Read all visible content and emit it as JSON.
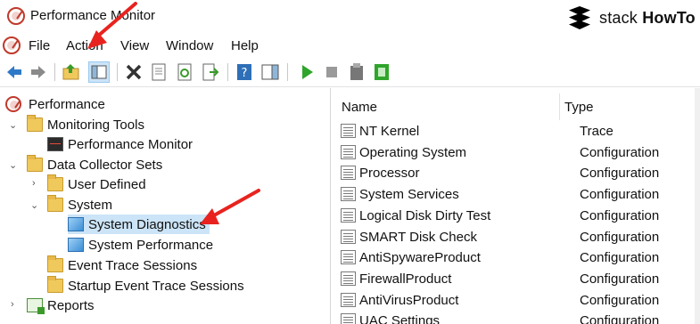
{
  "window": {
    "title": "Performance Monitor"
  },
  "brand": {
    "prefix": "stack",
    "suffix": "HowTo"
  },
  "menu": [
    "File",
    "Action",
    "View",
    "Window",
    "Help"
  ],
  "toolbar": {
    "buttons": [
      "back-icon",
      "forward-icon",
      "folder-up-icon",
      "show-hide-tree-icon",
      "delete-icon",
      "properties-icon",
      "refresh-icon",
      "export-icon",
      "help-icon",
      "show-hide-action-pane-icon",
      "start-icon",
      "stop-icon",
      "latest-report-icon",
      "new-data-collector-icon"
    ]
  },
  "tree": {
    "root": "Performance",
    "items": [
      {
        "label": "Monitoring Tools",
        "icon": "folder-icon",
        "expanded": true
      },
      {
        "label": "Performance Monitor",
        "icon": "monitor-icon"
      },
      {
        "label": "Data Collector Sets",
        "icon": "folder-icon",
        "expanded": true
      },
      {
        "label": "User Defined",
        "icon": "user-folder-icon",
        "expanded": false
      },
      {
        "label": "System",
        "icon": "system-folder-icon",
        "expanded": true
      },
      {
        "label": "System Diagnostics",
        "icon": "data-collector-icon",
        "selected": true
      },
      {
        "label": "System Performance",
        "icon": "data-collector-icon"
      },
      {
        "label": "Event Trace Sessions",
        "icon": "trace-folder-icon"
      },
      {
        "label": "Startup Event Trace Sessions",
        "icon": "trace-folder-icon"
      },
      {
        "label": "Reports",
        "icon": "reports-icon",
        "expanded": false
      }
    ]
  },
  "list": {
    "columns": [
      "Name",
      "Type"
    ],
    "rows": [
      {
        "name": "NT Kernel",
        "type": "Trace"
      },
      {
        "name": "Operating System",
        "type": "Configuration"
      },
      {
        "name": "Processor",
        "type": "Configuration"
      },
      {
        "name": "System Services",
        "type": "Configuration"
      },
      {
        "name": "Logical Disk Dirty Test",
        "type": "Configuration"
      },
      {
        "name": "SMART Disk Check",
        "type": "Configuration"
      },
      {
        "name": "AntiSpywareProduct",
        "type": "Configuration"
      },
      {
        "name": "FirewallProduct",
        "type": "Configuration"
      },
      {
        "name": "AntiVirusProduct",
        "type": "Configuration"
      },
      {
        "name": "UAC Settings",
        "type": "Configuration"
      }
    ]
  },
  "colors": {
    "selection": "#cce4f7",
    "arrow": "#e8231f"
  }
}
